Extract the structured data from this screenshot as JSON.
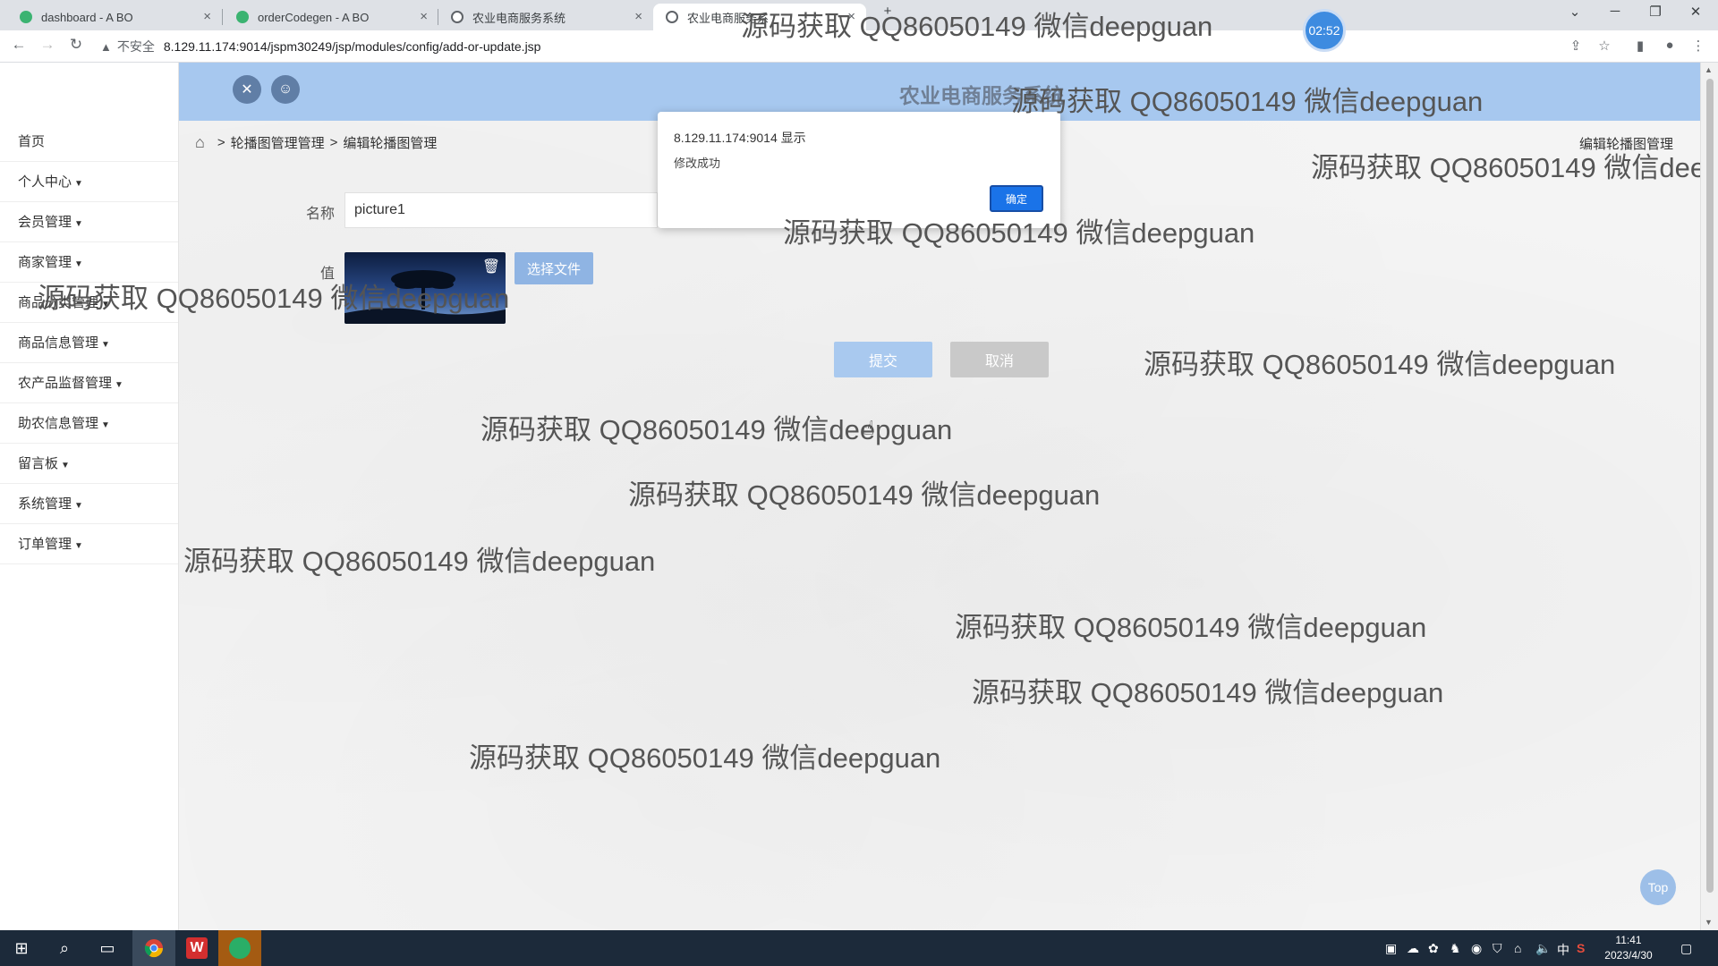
{
  "browser": {
    "tabs": [
      {
        "title": "dashboard - A BO"
      },
      {
        "title": "orderCodegen - A BO"
      },
      {
        "title": "农业电商服务系统"
      },
      {
        "title": "农业电商服务系"
      }
    ],
    "url_warning": "不安全",
    "url": "8.129.11.174:9014/jspm30249/jsp/modules/config/add-or-update.jsp",
    "timer": "02:52"
  },
  "alert": {
    "origin": "8.129.11.174:9014 显示",
    "message": "修改成功",
    "ok_label": "确定"
  },
  "sidebar": {
    "items": [
      {
        "label": "首页",
        "has_caret": false
      },
      {
        "label": "个人中心",
        "has_caret": true
      },
      {
        "label": "会员管理",
        "has_caret": true
      },
      {
        "label": "商家管理",
        "has_caret": true
      },
      {
        "label": "商品分类管理",
        "has_caret": true
      },
      {
        "label": "商品信息管理",
        "has_caret": true
      },
      {
        "label": "农产品监督管理",
        "has_caret": true
      },
      {
        "label": "助农信息管理",
        "has_caret": true
      },
      {
        "label": "留言板",
        "has_caret": true
      },
      {
        "label": "系统管理",
        "has_caret": true
      },
      {
        "label": "订单管理",
        "has_caret": true
      }
    ]
  },
  "header": {
    "system_title": "农业电商服务系统"
  },
  "breadcrumb": {
    "sep": ">",
    "level1": "轮播图管理管理",
    "level2": "编辑轮播图管理",
    "right_title": "编辑轮播图管理"
  },
  "form": {
    "name_label": "名称",
    "name_value": "picture1",
    "value_label": "值",
    "choose_file_label": "选择文件",
    "submit_label": "提交",
    "cancel_label": "取消"
  },
  "top_button": "Top",
  "watermark": "源码获取 QQ86050149 微信deepguan",
  "taskbar": {
    "time": "11:41",
    "date": "2023/4/30",
    "ime": "中"
  }
}
